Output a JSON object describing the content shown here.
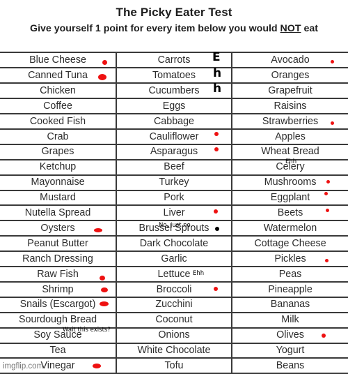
{
  "header": {
    "title": "The Picky Eater Test",
    "subtitle_before": "Give yourself 1 point for every item below you would ",
    "subtitle_emphasis": "NOT",
    "subtitle_after": " eat"
  },
  "columns": [
    [
      "Blue Cheese",
      "Canned Tuna",
      "Chicken",
      "Coffee",
      "Cooked Fish",
      "Crab",
      "Grapes",
      "Ketchup",
      "Mayonnaise",
      "Mustard",
      "Nutella Spread",
      "Oysters",
      "Peanut Butter",
      "Ranch Dressing",
      "Raw Fish",
      "Shrimp",
      "Snails (Escargot)",
      "Sourdough Bread",
      "Soy Sauce",
      "Tea",
      "Vinegar"
    ],
    [
      "Carrots",
      "Tomatoes",
      "Cucumbers",
      "Eggs",
      "Cabbage",
      "Cauliflower",
      "Asparagus",
      "Beef",
      "Turkey",
      "Pork",
      "Liver",
      "Brussel Sprouts",
      "Dark Chocolate",
      "Garlic",
      "Lettuce",
      "Broccoli",
      "Zucchini",
      "Coconut",
      "Onions",
      "White Chocolate",
      "Tofu"
    ],
    [
      "Avocado",
      "Oranges",
      "Grapefruit",
      "Raisins",
      "Strawberries",
      "Apples",
      "Wheat Bread",
      "Celery",
      "Mushrooms",
      "Eggplant",
      "Beets",
      "Watermelon",
      "Cottage Cheese",
      "Pickles",
      "Peas",
      "Pineapple",
      "Bananas",
      "Milk",
      "Olives",
      "Yogurt",
      "Beans"
    ]
  ],
  "marked_items": [
    "Blue Cheese",
    "Canned Tuna",
    "Oysters",
    "Raw Fish",
    "Shrimp",
    "Snails (Escargot)",
    "Vinegar",
    "Cauliflower",
    "Asparagus",
    "Liver",
    "Brussel Sprouts",
    "Broccoli",
    "Avocado",
    "Strawberries",
    "Mushrooms",
    "Eggplant",
    "Beets",
    "Pickles",
    "Olives"
  ],
  "mark_colors": {
    "red": "#ee1111",
    "black": "#000000"
  },
  "annotations": {
    "eh_letters": [
      "E",
      "h",
      "h"
    ],
    "celery_note": "Ehh",
    "brussel_note": "No, just no.",
    "lettuce_note": "Ehh",
    "soy_note": "Wait this exists?"
  },
  "watermark": "imgflip.com"
}
